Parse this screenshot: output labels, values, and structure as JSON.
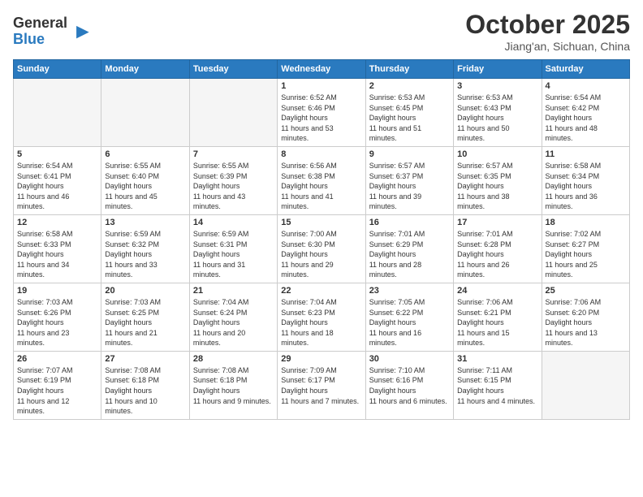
{
  "logo": {
    "general": "General",
    "blue": "Blue"
  },
  "header": {
    "month": "October 2025",
    "location": "Jiang'an, Sichuan, China"
  },
  "weekdays": [
    "Sunday",
    "Monday",
    "Tuesday",
    "Wednesday",
    "Thursday",
    "Friday",
    "Saturday"
  ],
  "weeks": [
    [
      {
        "day": "",
        "empty": true
      },
      {
        "day": "",
        "empty": true
      },
      {
        "day": "",
        "empty": true
      },
      {
        "day": "1",
        "sunrise": "6:52 AM",
        "sunset": "6:46 PM",
        "daylight": "11 hours and 53 minutes."
      },
      {
        "day": "2",
        "sunrise": "6:53 AM",
        "sunset": "6:45 PM",
        "daylight": "11 hours and 51 minutes."
      },
      {
        "day": "3",
        "sunrise": "6:53 AM",
        "sunset": "6:43 PM",
        "daylight": "11 hours and 50 minutes."
      },
      {
        "day": "4",
        "sunrise": "6:54 AM",
        "sunset": "6:42 PM",
        "daylight": "11 hours and 48 minutes."
      }
    ],
    [
      {
        "day": "5",
        "sunrise": "6:54 AM",
        "sunset": "6:41 PM",
        "daylight": "11 hours and 46 minutes."
      },
      {
        "day": "6",
        "sunrise": "6:55 AM",
        "sunset": "6:40 PM",
        "daylight": "11 hours and 45 minutes."
      },
      {
        "day": "7",
        "sunrise": "6:55 AM",
        "sunset": "6:39 PM",
        "daylight": "11 hours and 43 minutes."
      },
      {
        "day": "8",
        "sunrise": "6:56 AM",
        "sunset": "6:38 PM",
        "daylight": "11 hours and 41 minutes."
      },
      {
        "day": "9",
        "sunrise": "6:57 AM",
        "sunset": "6:37 PM",
        "daylight": "11 hours and 39 minutes."
      },
      {
        "day": "10",
        "sunrise": "6:57 AM",
        "sunset": "6:35 PM",
        "daylight": "11 hours and 38 minutes."
      },
      {
        "day": "11",
        "sunrise": "6:58 AM",
        "sunset": "6:34 PM",
        "daylight": "11 hours and 36 minutes."
      }
    ],
    [
      {
        "day": "12",
        "sunrise": "6:58 AM",
        "sunset": "6:33 PM",
        "daylight": "11 hours and 34 minutes."
      },
      {
        "day": "13",
        "sunrise": "6:59 AM",
        "sunset": "6:32 PM",
        "daylight": "11 hours and 33 minutes."
      },
      {
        "day": "14",
        "sunrise": "6:59 AM",
        "sunset": "6:31 PM",
        "daylight": "11 hours and 31 minutes."
      },
      {
        "day": "15",
        "sunrise": "7:00 AM",
        "sunset": "6:30 PM",
        "daylight": "11 hours and 29 minutes."
      },
      {
        "day": "16",
        "sunrise": "7:01 AM",
        "sunset": "6:29 PM",
        "daylight": "11 hours and 28 minutes."
      },
      {
        "day": "17",
        "sunrise": "7:01 AM",
        "sunset": "6:28 PM",
        "daylight": "11 hours and 26 minutes."
      },
      {
        "day": "18",
        "sunrise": "7:02 AM",
        "sunset": "6:27 PM",
        "daylight": "11 hours and 25 minutes."
      }
    ],
    [
      {
        "day": "19",
        "sunrise": "7:03 AM",
        "sunset": "6:26 PM",
        "daylight": "11 hours and 23 minutes."
      },
      {
        "day": "20",
        "sunrise": "7:03 AM",
        "sunset": "6:25 PM",
        "daylight": "11 hours and 21 minutes."
      },
      {
        "day": "21",
        "sunrise": "7:04 AM",
        "sunset": "6:24 PM",
        "daylight": "11 hours and 20 minutes."
      },
      {
        "day": "22",
        "sunrise": "7:04 AM",
        "sunset": "6:23 PM",
        "daylight": "11 hours and 18 minutes."
      },
      {
        "day": "23",
        "sunrise": "7:05 AM",
        "sunset": "6:22 PM",
        "daylight": "11 hours and 16 minutes."
      },
      {
        "day": "24",
        "sunrise": "7:06 AM",
        "sunset": "6:21 PM",
        "daylight": "11 hours and 15 minutes."
      },
      {
        "day": "25",
        "sunrise": "7:06 AM",
        "sunset": "6:20 PM",
        "daylight": "11 hours and 13 minutes."
      }
    ],
    [
      {
        "day": "26",
        "sunrise": "7:07 AM",
        "sunset": "6:19 PM",
        "daylight": "11 hours and 12 minutes."
      },
      {
        "day": "27",
        "sunrise": "7:08 AM",
        "sunset": "6:18 PM",
        "daylight": "11 hours and 10 minutes."
      },
      {
        "day": "28",
        "sunrise": "7:08 AM",
        "sunset": "6:18 PM",
        "daylight": "11 hours and 9 minutes."
      },
      {
        "day": "29",
        "sunrise": "7:09 AM",
        "sunset": "6:17 PM",
        "daylight": "11 hours and 7 minutes."
      },
      {
        "day": "30",
        "sunrise": "7:10 AM",
        "sunset": "6:16 PM",
        "daylight": "11 hours and 6 minutes."
      },
      {
        "day": "31",
        "sunrise": "7:11 AM",
        "sunset": "6:15 PM",
        "daylight": "11 hours and 4 minutes."
      },
      {
        "day": "",
        "empty": true
      }
    ]
  ]
}
